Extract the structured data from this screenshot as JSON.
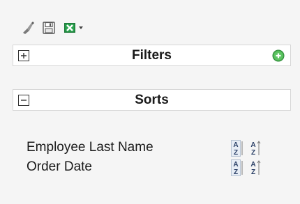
{
  "toolbar": {
    "icons": [
      "brush-icon",
      "save-icon",
      "excel-export-icon",
      "dropdown-arrow-icon"
    ]
  },
  "filters": {
    "title": "Filters",
    "toggle_icon": "expand-plus-icon",
    "add_icon": "add-green-circle-icon"
  },
  "sorts": {
    "title": "Sorts",
    "toggle_icon": "collapse-minus-icon",
    "items": [
      {
        "label": "Employee Last Name"
      },
      {
        "label": "Order Date"
      }
    ],
    "sort_letters": {
      "top": "A",
      "bottom": "Z"
    }
  },
  "colors": {
    "panel_border": "#d6d6d6",
    "panel_bg": "#ffffff",
    "page_bg": "#f5f5f5",
    "add_green": "#4caf50",
    "excel_green": "#1d7a3a"
  }
}
